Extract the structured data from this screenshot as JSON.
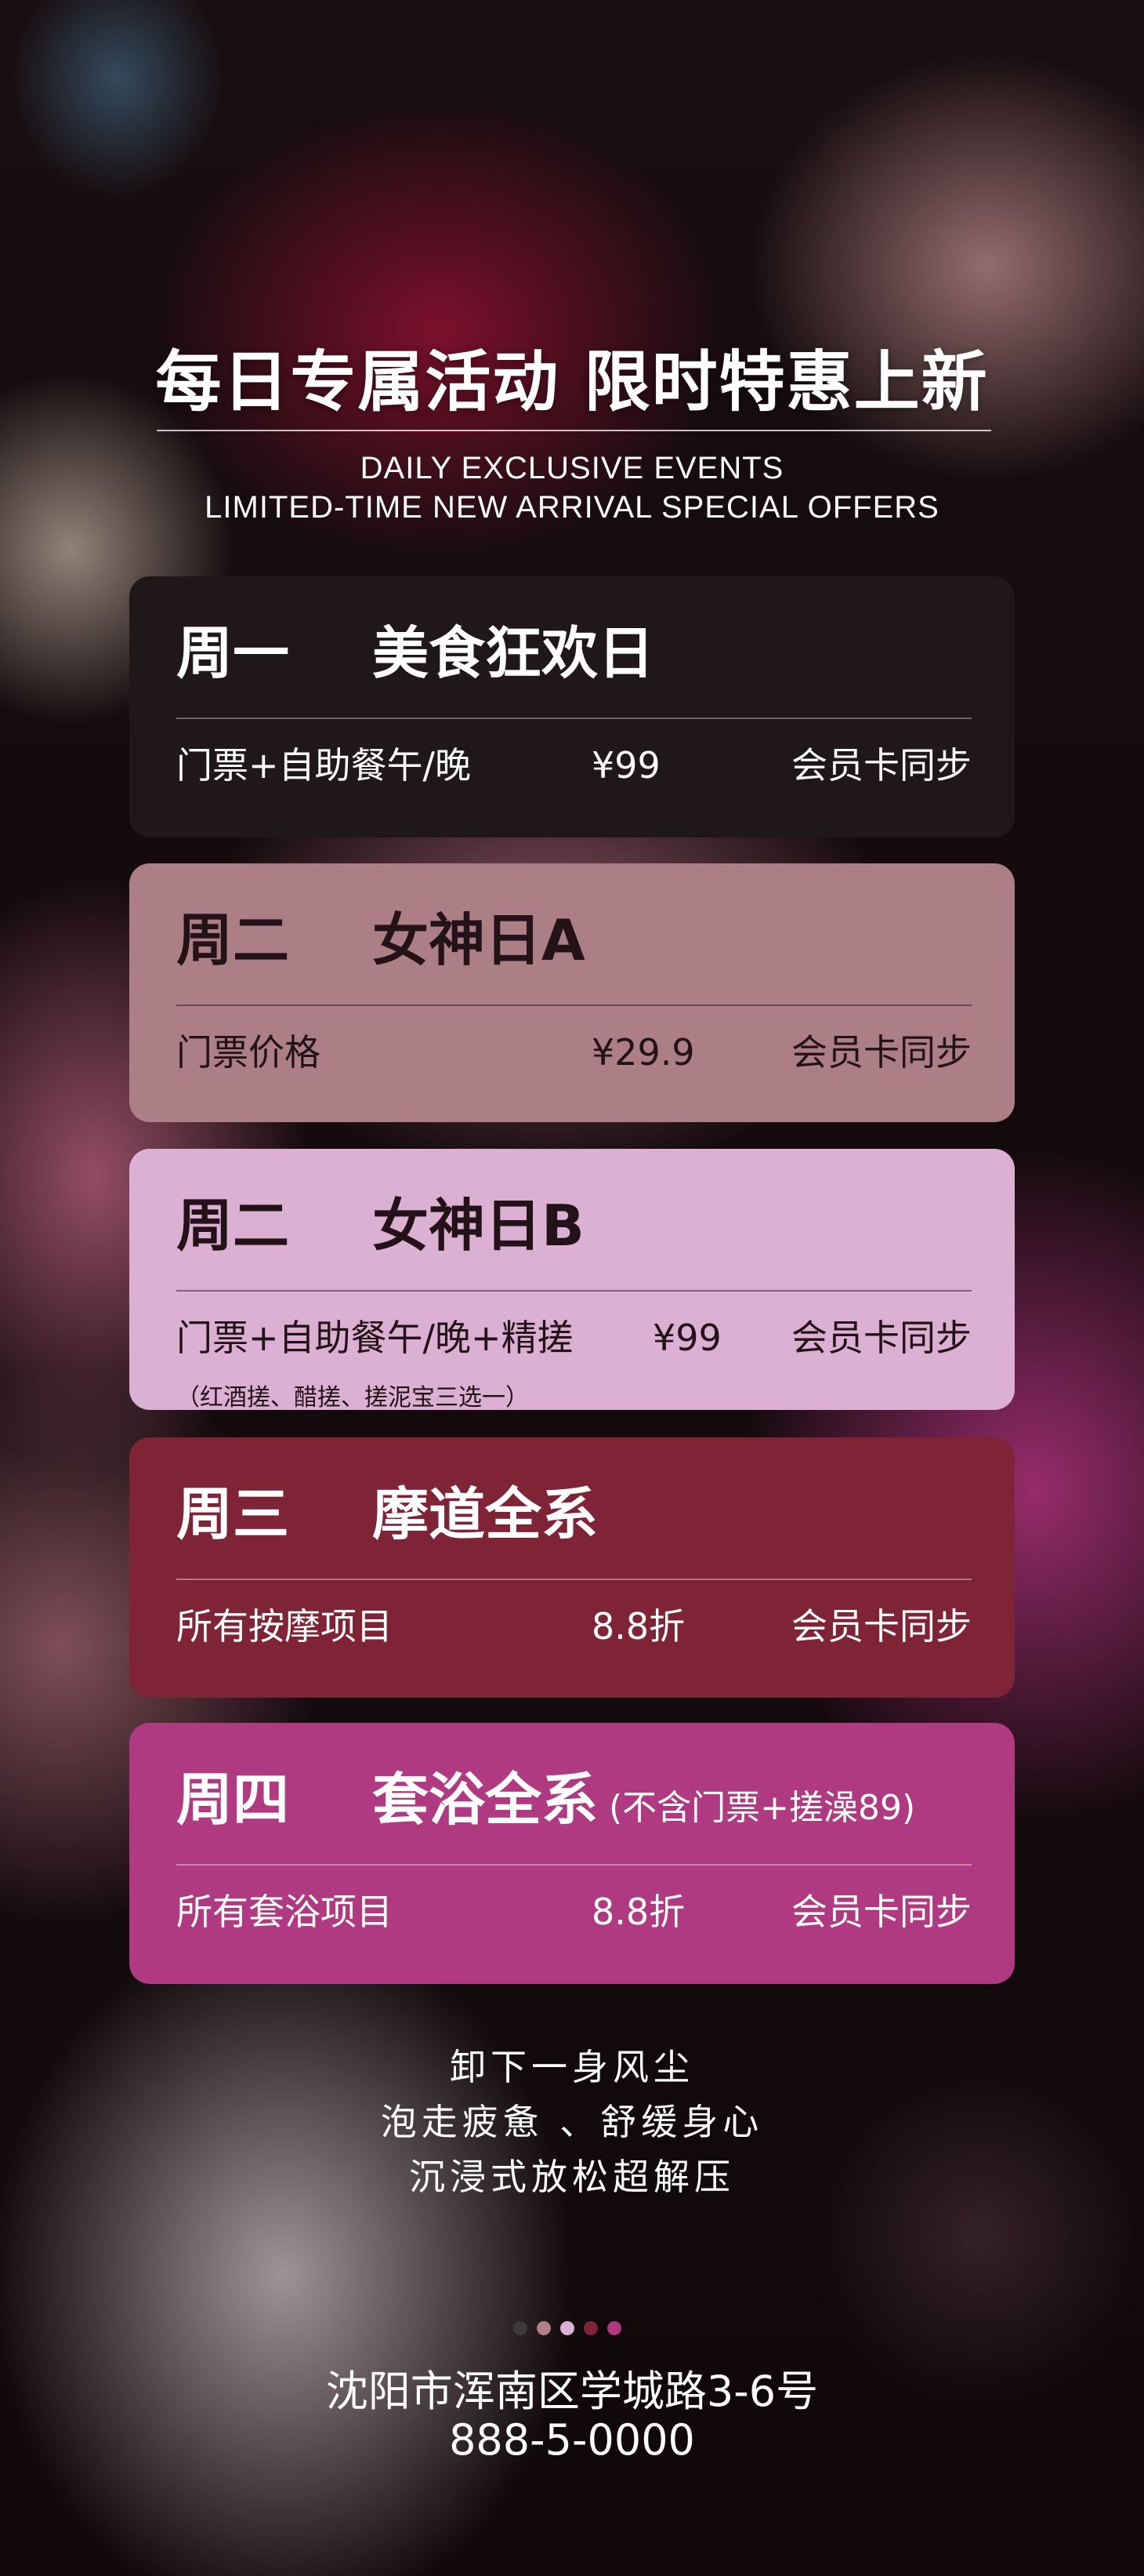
{
  "header": {
    "title": "每日专属活动 限时特惠上新",
    "subtitle_line1": "DAILY EXCLUSIVE EVENTS",
    "subtitle_line2": "LIMITED-TIME NEW ARRIVAL SPECIAL OFFERS"
  },
  "cards": [
    {
      "day": "周一",
      "name": "美食狂欢日",
      "item": "门票+自助餐午/晚",
      "price": "¥99",
      "member": "会员卡同步",
      "color": "#201719"
    },
    {
      "day": "周二",
      "name": "女神日A",
      "item": "门票价格",
      "price": "¥29.9",
      "member": "会员卡同步",
      "color": "#ac7f87"
    },
    {
      "day": "周二",
      "name": "女神日B",
      "item": "门票+自助餐午/晚+精搓",
      "price": "¥99",
      "member": "会员卡同步",
      "extra": "（红酒搓、醋搓、搓泥宝三选一）",
      "color": "#dbb0d3"
    },
    {
      "day": "周三",
      "name": "摩道全系",
      "item": "所有按摩项目",
      "price": "8.8折",
      "member": "会员卡同步",
      "color": "#7e2436"
    },
    {
      "day": "周四",
      "name": "套浴全系",
      "note": "(不含门票+搓澡89)",
      "item": "所有套浴项目",
      "price": "8.8折",
      "member": "会员卡同步",
      "color": "#b03a82"
    }
  ],
  "slogan": {
    "line1": "卸下一身风尘",
    "line2": "泡走疲惫 、舒缓身心",
    "line3": "沉浸式放松超解压"
  },
  "pagination_dot_colors": [
    "#3a3a3a",
    "#b07f88",
    "#dbb0d3",
    "#7e2436",
    "#b03a82"
  ],
  "footer": {
    "address": "沈阳市浑南区学城路3-6号",
    "phone": "888-5-0000"
  }
}
